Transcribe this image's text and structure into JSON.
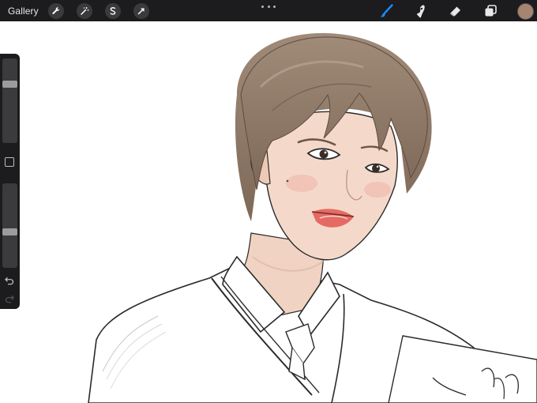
{
  "app": {
    "gallery_label": "Gallery"
  },
  "toolbar": {
    "left_tools": [
      "wrench-icon",
      "magic-wand-icon",
      "selection-icon",
      "transform-arrow-icon"
    ],
    "right_tools": [
      "brush-icon",
      "smudge-icon",
      "eraser-icon",
      "layers-icon"
    ],
    "active_tool": "brush-icon",
    "active_color": "#a78470",
    "accent_color": "#1a8cff"
  },
  "sidebar": {
    "brush_size_level": 0.71,
    "opacity_level": 0.42
  },
  "colors": {
    "hair": "#8f7765",
    "skin": "#f2d7c8",
    "line": "#2a2a2a"
  }
}
